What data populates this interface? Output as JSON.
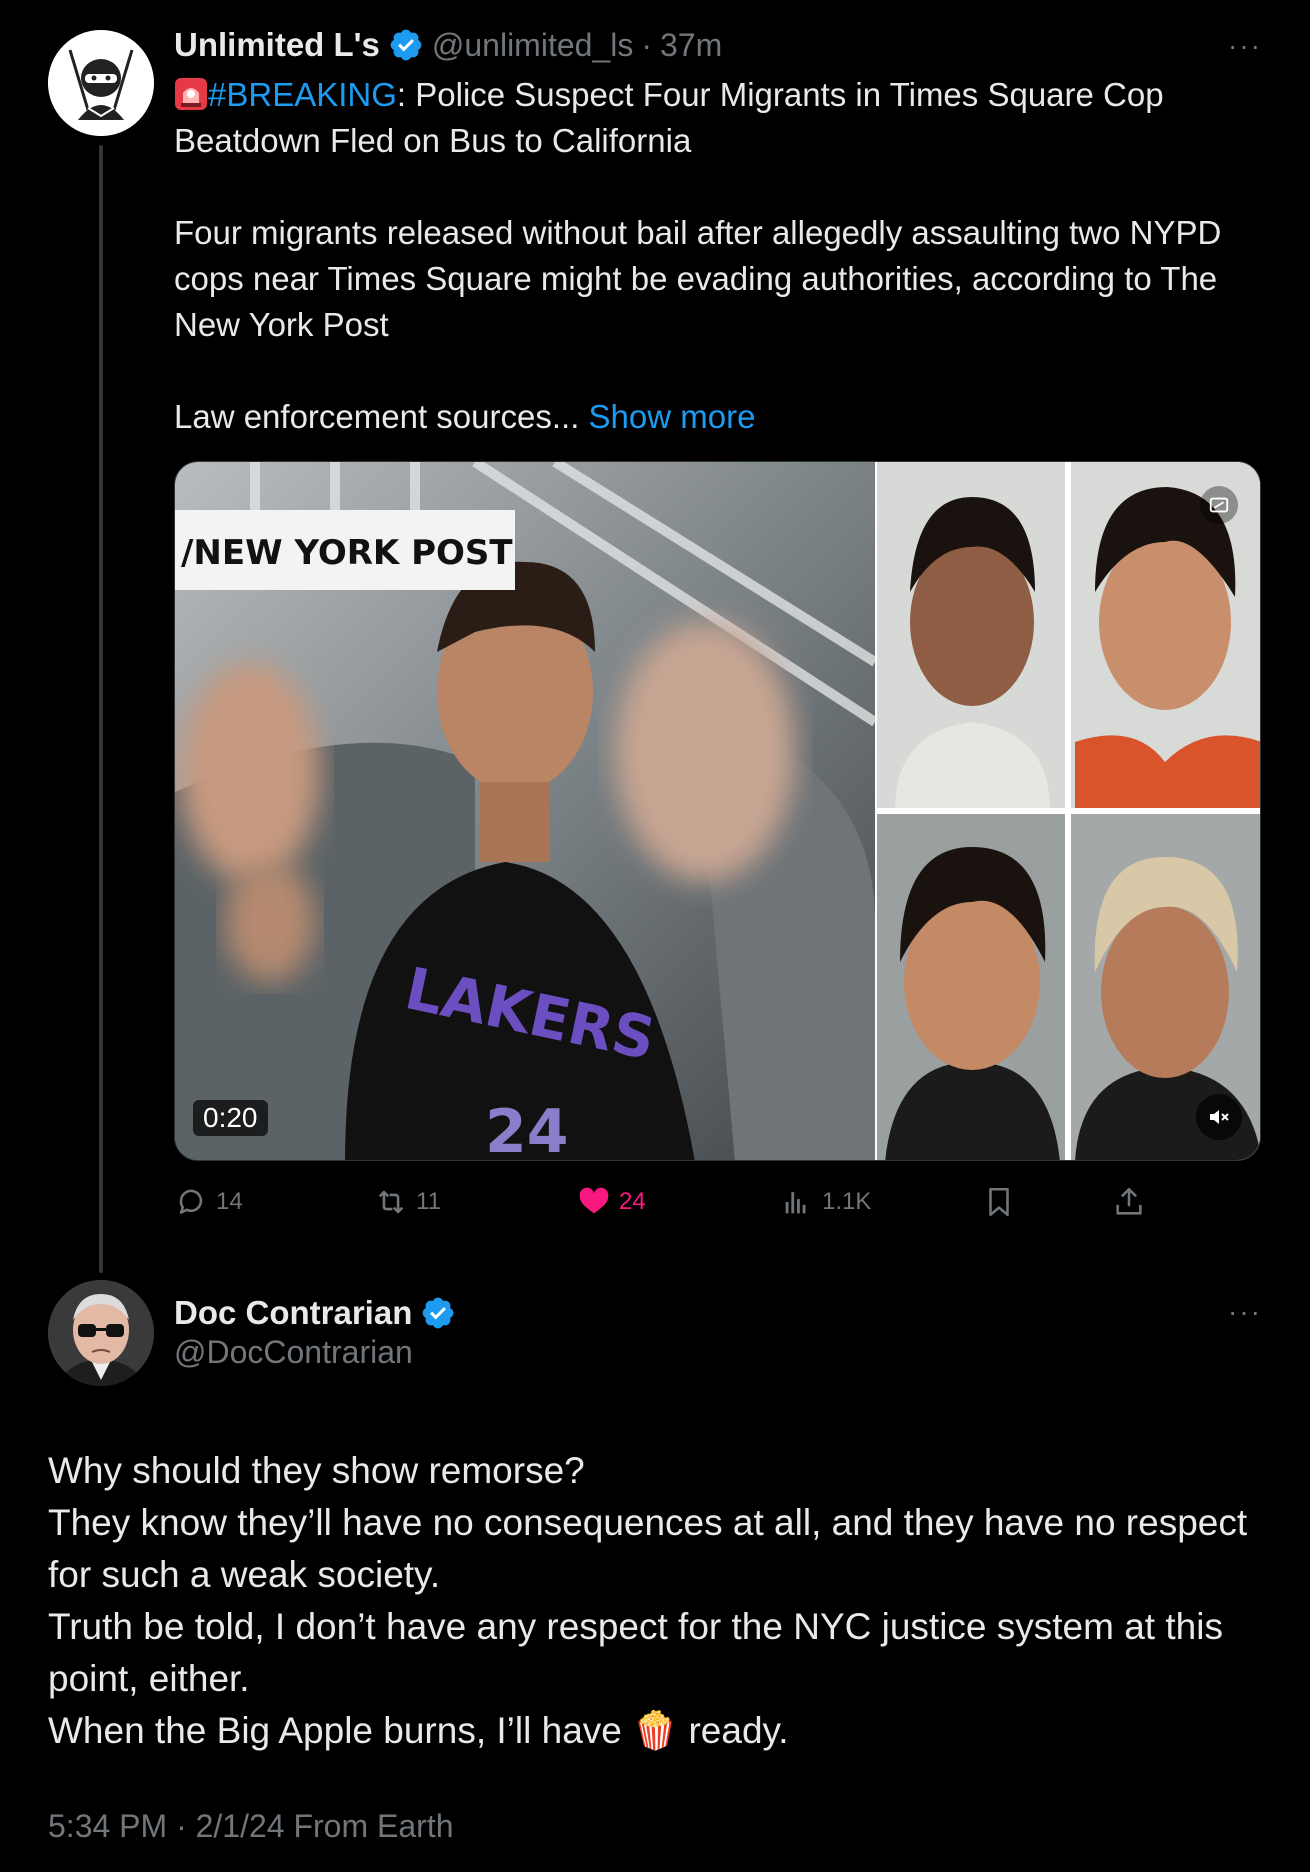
{
  "original_post": {
    "author_name": "Unlimited L's",
    "handle": "@unlimited_ls",
    "separator": "·",
    "time": "37m",
    "headline_prefix_icon": "siren-emoji",
    "hashtag": "#BREAKING",
    "headline_rest": ": Police Suspect Four Migrants in Times Square Cop Beatdown Fled on Bus to California",
    "paragraph": "Four migrants released without bail after allegedly assaulting two NYPD cops near Times Square might be evading authorities, according to The New York Post",
    "teaser": "Law enforcement sources...",
    "show_more": "Show more",
    "media": {
      "watermark": "/NEW YORK POST",
      "shirt_text": "LAKERS",
      "duration": "0:20"
    },
    "stats": {
      "replies": "14",
      "reposts": "11",
      "likes": "24",
      "views": "1.1K"
    },
    "like_color": "#f91880"
  },
  "reply": {
    "author_name": "Doc Contrarian",
    "handle": "@DocContrarian",
    "lines": [
      "Why should they show remorse?",
      "They know they’ll have no consequences at all, and they have no respect for such a weak society.",
      "Truth be told, I don’t have any respect for the NYC justice system at this point, either.",
      "When the Big Apple burns, I’ll have"
    ],
    "emoji": "🍿",
    "last_line_suffix": " ready.",
    "footer": "5:34 PM · 2/1/24 From Earth"
  },
  "colors": {
    "background": "#000000",
    "text": "#e7e9ea",
    "muted": "#71767b",
    "link": "#1d9bf0",
    "verified": "#1d9bf0"
  }
}
